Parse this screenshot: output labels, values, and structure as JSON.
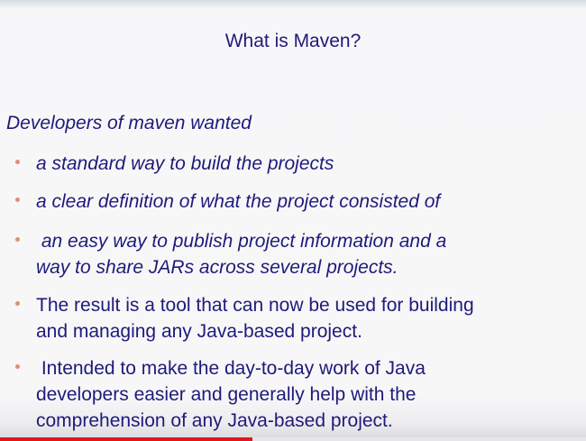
{
  "slide": {
    "title": "What is Maven?",
    "intro": "Developers of maven wanted",
    "bullets": [
      {
        "text": "a standard way to build the projects"
      },
      {
        "text": "a clear definition of what the project consisted of"
      },
      {
        "text": " an easy way to publish project information and a\nway to share JARs across several projects."
      },
      {
        "text": "The result is a tool that can now be used for building\nand managing any Java-based project."
      },
      {
        "text": " Intended to make the day-to-day work of Java\ndevelopers easier and generally help with the\ncomprehension of any Java-based project."
      }
    ]
  },
  "player": {
    "progress_fraction": 0.43,
    "progress_color": "#e2161e"
  },
  "colors": {
    "text": "#1f1a7a",
    "bullet": "#e98a73",
    "background": "#f7f7f8"
  }
}
